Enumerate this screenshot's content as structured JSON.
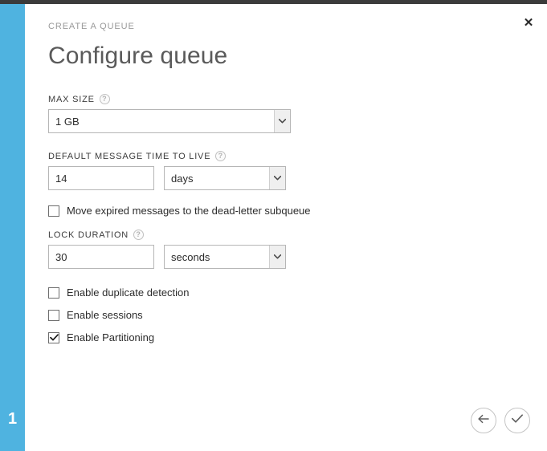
{
  "window": {
    "close_label": "✕",
    "accent_color": "#4fb3e0",
    "step_number": "1"
  },
  "header": {
    "eyebrow": "CREATE A QUEUE",
    "title": "Configure queue"
  },
  "form": {
    "help_glyph": "?",
    "max_size": {
      "label": "MAX SIZE",
      "value": "1 GB"
    },
    "default_ttl": {
      "label": "DEFAULT MESSAGE TIME TO LIVE",
      "amount": "14",
      "unit": "days"
    },
    "dead_letter": {
      "label": "Move expired messages to the dead-letter subqueue",
      "checked": false
    },
    "lock_duration": {
      "label": "LOCK DURATION",
      "amount": "30",
      "unit": "seconds"
    },
    "options": [
      {
        "label": "Enable duplicate detection",
        "checked": false
      },
      {
        "label": "Enable sessions",
        "checked": false
      },
      {
        "label": "Enable Partitioning",
        "checked": true
      }
    ]
  },
  "footer": {
    "back_icon": "arrow-left-icon",
    "confirm_icon": "check-icon"
  }
}
